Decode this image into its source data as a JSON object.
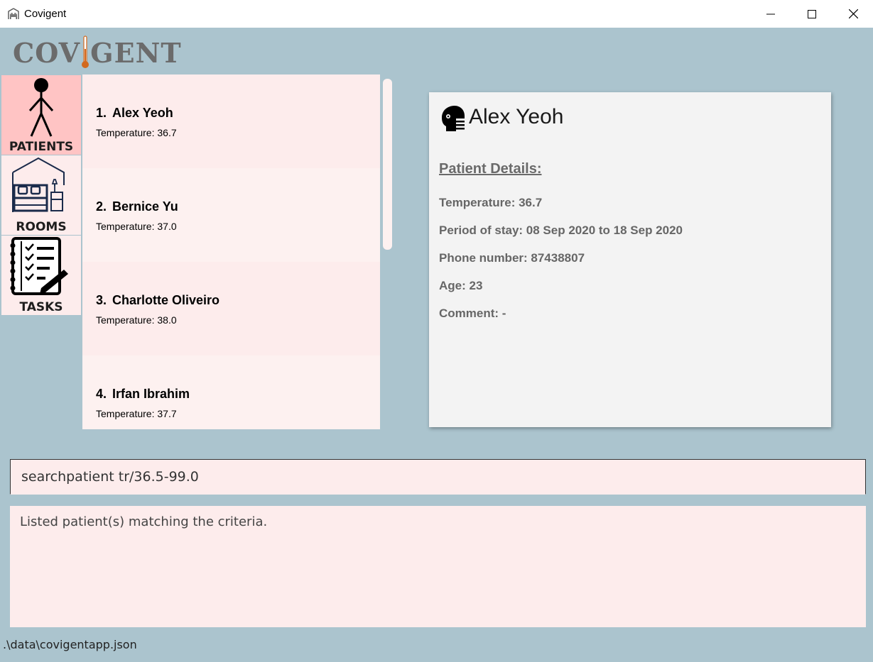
{
  "window": {
    "title": "Covigent",
    "minimize_icon": "minimize-icon",
    "maximize_icon": "maximize-icon",
    "close_icon": "close-icon"
  },
  "logo": {
    "text_left": "COV",
    "text_right": "GENT"
  },
  "nav": [
    {
      "label": "PATIENTS",
      "icon": "person-icon",
      "active": true
    },
    {
      "label": "ROOMS",
      "icon": "bed-icon",
      "active": false
    },
    {
      "label": "TASKS",
      "icon": "checklist-icon",
      "active": false
    }
  ],
  "patients": [
    {
      "index": "1.",
      "name": "Alex Yeoh",
      "temperature": "Temperature: 36.7"
    },
    {
      "index": "2.",
      "name": "Bernice Yu",
      "temperature": "Temperature: 37.0"
    },
    {
      "index": "3.",
      "name": "Charlotte Oliveiro",
      "temperature": "Temperature: 38.0"
    },
    {
      "index": "4.",
      "name": "Irfan Ibrahim",
      "temperature": "Temperature: 37.7"
    }
  ],
  "detail": {
    "name": "Alex Yeoh",
    "section_title": "Patient Details:",
    "temperature": "Temperature: 36.7",
    "period": "Period of stay: 08 Sep 2020 to 18 Sep 2020",
    "phone": "Phone number: 87438807",
    "age": "Age: 23",
    "comment": "Comment: -"
  },
  "command": {
    "value": "searchpatient tr/36.5-99.0"
  },
  "result": {
    "message": "Listed patient(s) matching the criteria."
  },
  "status": {
    "path": ".\\data\\covigentapp.json"
  },
  "colors": {
    "background": "#abc4ce",
    "active_tab": "#ffc4c4",
    "card": "#fdecec",
    "logo_accent": "#d2691e"
  }
}
